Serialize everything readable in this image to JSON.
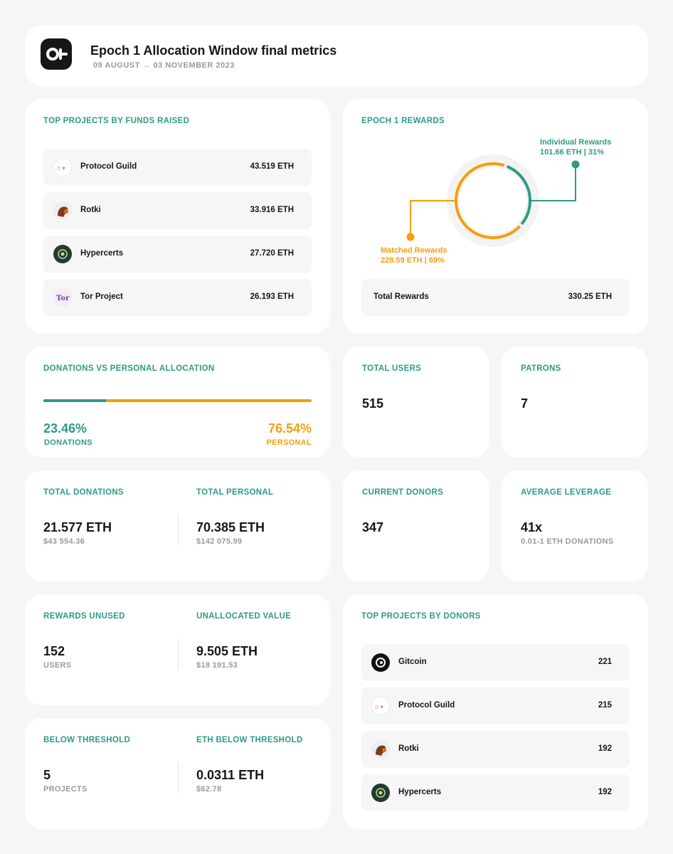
{
  "header": {
    "title": "Epoch 1 Allocation Window final metrics",
    "dates": "09 AUGUST → 03 NOVEMBER 2023"
  },
  "top_funds": {
    "title": "TOP PROJECTS BY FUNDS RAISED",
    "items": [
      {
        "name": "Protocol Guild",
        "value": "43.519 ETH"
      },
      {
        "name": "Rotki",
        "value": "33.916 ETH"
      },
      {
        "name": "Hypercerts",
        "value": "27.720 ETH"
      },
      {
        "name": "Tor Project",
        "value": "26.193 ETH"
      }
    ]
  },
  "rewards": {
    "title": "EPOCH 1 REWARDS",
    "individual_label": "Individual Rewards",
    "individual_value": "101.66 ETH | 31%",
    "individual_fraction": 0.31,
    "matched_label": "Matched Rewards",
    "matched_value": "228.59 ETH | 69%",
    "total_label": "Total Rewards",
    "total_value": "330.25 ETH",
    "colors": {
      "individual": "#2d9b87",
      "matched": "#f59e0b"
    }
  },
  "allocation": {
    "title": "DONATIONS VS PERSONAL ALLOCATION",
    "donations_pct": "23.46%",
    "donations_label": "DONATIONS",
    "personal_pct": "76.54%",
    "personal_label": "PERSONAL",
    "donations_fraction": 0.2346
  },
  "total_users": {
    "label": "TOTAL USERS",
    "value": "515"
  },
  "patrons": {
    "label": "PATRONS",
    "value": "7"
  },
  "donations_personal": {
    "donations_label": "TOTAL DONATIONS",
    "donations_value": "21.577 ETH",
    "donations_usd": "$43 554.36",
    "personal_label": "TOTAL PERSONAL",
    "personal_value": "70.385 ETH",
    "personal_usd": "$142 075.99"
  },
  "current_donors": {
    "label": "CURRENT DONORS",
    "value": "347"
  },
  "leverage": {
    "label": "AVERAGE LEVERAGE",
    "value": "41x",
    "sub": "0.01-1 ETH DONATIONS"
  },
  "unused": {
    "rewards_label": "REWARDS UNUSED",
    "rewards_value": "152",
    "rewards_sub": "USERS",
    "unalloc_label": "UNALLOCATED VALUE",
    "unalloc_value": "9.505 ETH",
    "unalloc_sub": "$18 191.53"
  },
  "threshold": {
    "below_label": "BELOW THRESHOLD",
    "below_value": "5",
    "below_sub": "PROJECTS",
    "eth_label": "ETH BELOW THRESHOLD",
    "eth_value": "0.0311 ETH",
    "eth_sub": "$62.78"
  },
  "top_donors": {
    "title": "TOP PROJECTS BY DONORS",
    "items": [
      {
        "name": "Gitcoin",
        "value": "221"
      },
      {
        "name": "Protocol Guild",
        "value": "215"
      },
      {
        "name": "Rotki",
        "value": "192"
      },
      {
        "name": "Hypercerts",
        "value": "192"
      }
    ]
  },
  "colors": {
    "accent": "#2d9b87",
    "orange": "#f59e0b",
    "background": "#f6f6f6"
  }
}
